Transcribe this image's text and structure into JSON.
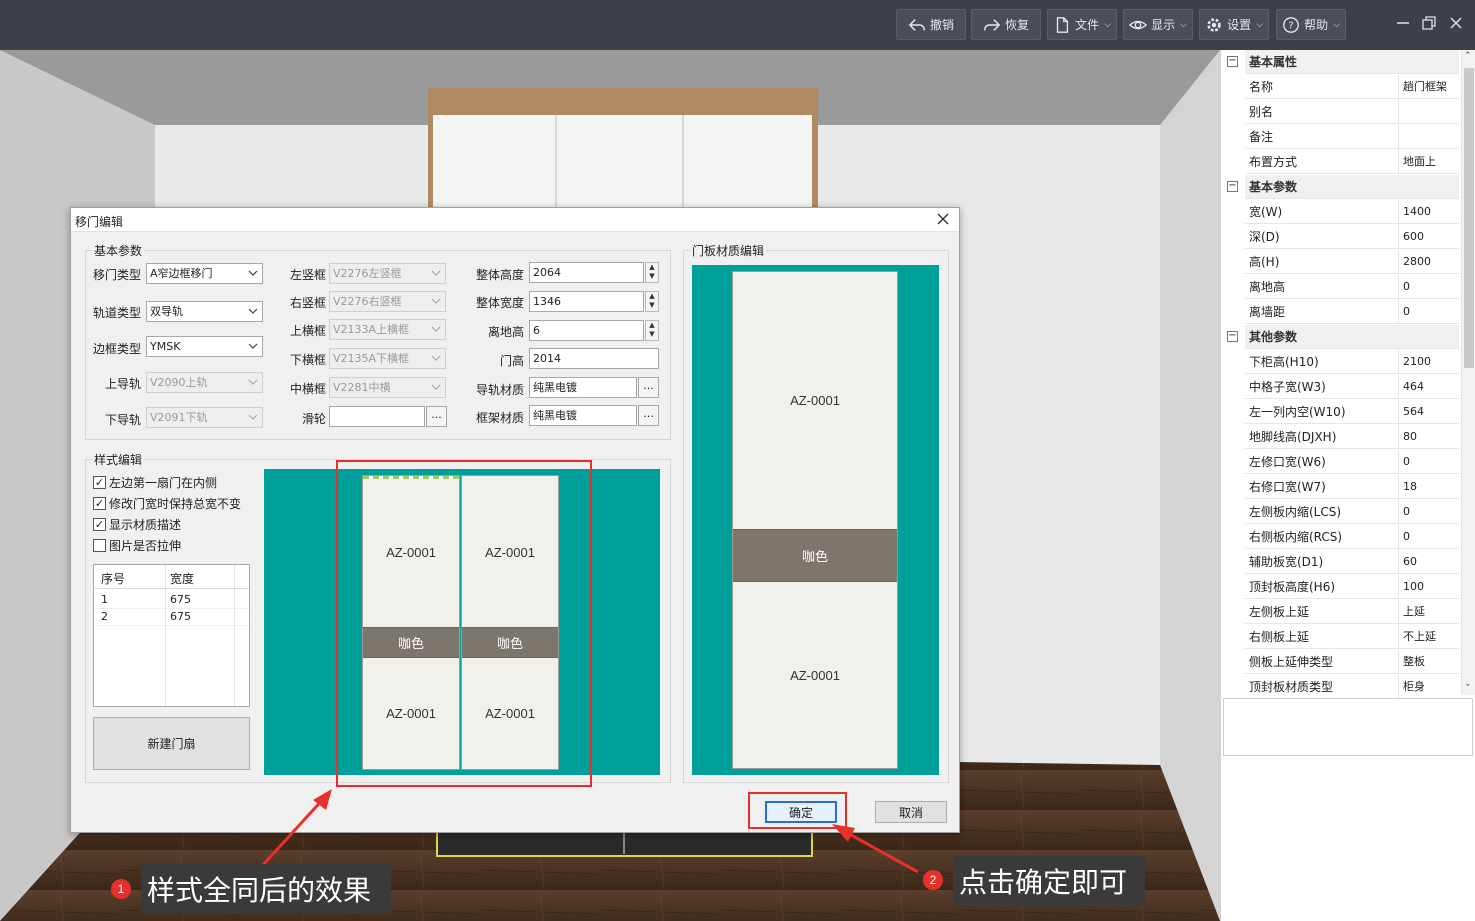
{
  "toolbar": {
    "undo": "撤销",
    "redo": "恢复",
    "file": "文件",
    "display": "显示",
    "settings": "设置",
    "help": "帮助"
  },
  "properties": {
    "groups": [
      {
        "title": "基本属性",
        "rows": [
          {
            "key": "名称",
            "value": "趟门框架"
          },
          {
            "key": "别名",
            "value": ""
          },
          {
            "key": "备注",
            "value": ""
          },
          {
            "key": "布置方式",
            "value": "地面上"
          }
        ]
      },
      {
        "title": "基本参数",
        "rows": [
          {
            "key": "宽(W)",
            "value": "1400"
          },
          {
            "key": "深(D)",
            "value": "600"
          },
          {
            "key": "高(H)",
            "value": "2800"
          },
          {
            "key": "离地高",
            "value": "0"
          },
          {
            "key": "离墙距",
            "value": "0"
          }
        ]
      },
      {
        "title": "其他参数",
        "rows": [
          {
            "key": "下柜高(H10)",
            "value": "2100"
          },
          {
            "key": "中格子宽(W3)",
            "value": "464"
          },
          {
            "key": "左一列内空(W10)",
            "value": "564"
          },
          {
            "key": "地脚线高(DJXH)",
            "value": "80"
          },
          {
            "key": "左修口宽(W6)",
            "value": "0"
          },
          {
            "key": "右修口宽(W7)",
            "value": "18"
          },
          {
            "key": "左侧板内缩(LCS)",
            "value": "0"
          },
          {
            "key": "右侧板内缩(RCS)",
            "value": "0"
          },
          {
            "key": "辅助板宽(D1)",
            "value": "60"
          },
          {
            "key": "顶封板高度(H6)",
            "value": "100"
          },
          {
            "key": "左侧板上延",
            "value": "上延"
          },
          {
            "key": "右侧板上延",
            "value": "不上延"
          },
          {
            "key": "侧板上延伸类型",
            "value": "整板"
          },
          {
            "key": "顶封板材质类型",
            "value": "柜身"
          }
        ]
      }
    ]
  },
  "dialog": {
    "title": "移门编辑",
    "basic_params": {
      "group_title": "基本参数",
      "door_type_label": "移门类型",
      "door_type": "A窄边框移门",
      "track_type_label": "轨道类型",
      "track_type": "双导轨",
      "frame_type_label": "边框类型",
      "frame_type": "YMSK",
      "upper_rail_label": "上导轨",
      "upper_rail": "V2090上轨",
      "lower_rail_label": "下导轨",
      "lower_rail": "V2091下轨",
      "left_stile_label": "左竖框",
      "left_stile": "V2276左竖框",
      "right_stile_label": "右竖框",
      "right_stile": "V2276右竖框",
      "top_rail_label": "上横框",
      "top_rail": "V2133A上横框",
      "bottom_rail_label": "下横框",
      "bottom_rail": "V2135A下横框",
      "mid_rail_label": "中横框",
      "mid_rail": "V2281中横",
      "pulley_label": "滑轮",
      "pulley": "",
      "total_height_label": "整体高度",
      "total_height": "2064",
      "total_width_label": "整体宽度",
      "total_width": "1346",
      "ground_height_label": "离地高",
      "ground_height": "6",
      "door_height_label": "门高",
      "door_height": "2014",
      "rail_material_label": "导轨材质",
      "rail_material": "纯黑电镀",
      "frame_material_label": "框架材质",
      "frame_material": "纯黑电镀",
      "browse": "..."
    },
    "style_edit": {
      "group_title": "样式编辑",
      "options": [
        {
          "label": "左边第一扇门在内侧",
          "checked": true
        },
        {
          "label": "修改门宽时保持总宽不变",
          "checked": true
        },
        {
          "label": "显示材质描述",
          "checked": true
        },
        {
          "label": "图片是否拉伸",
          "checked": false
        }
      ],
      "table_headers": [
        "序号",
        "宽度"
      ],
      "table_rows": [
        [
          "1",
          "675"
        ],
        [
          "2",
          "675"
        ]
      ],
      "new_door_button": "新建门扇",
      "doors": [
        {
          "top": "AZ-0001",
          "mid": "咖色",
          "bottom": "AZ-0001"
        },
        {
          "top": "AZ-0001",
          "mid": "咖色",
          "bottom": "AZ-0001"
        }
      ]
    },
    "panel_material": {
      "group_title": "门板材质编辑",
      "top": "AZ-0001",
      "mid": "咖色",
      "bottom": "AZ-0001"
    },
    "ok": "确定",
    "cancel": "取消"
  },
  "annotations": {
    "note1_num": "1",
    "note1_text": "样式全同后的效果",
    "note2_num": "2",
    "note2_text": "点击确定即可"
  },
  "colors": {
    "toolbar_bg": "#3c4049",
    "preview_bg": "#00a09a",
    "mid_panel": "#7d766d",
    "highlight": "#e8302b"
  }
}
